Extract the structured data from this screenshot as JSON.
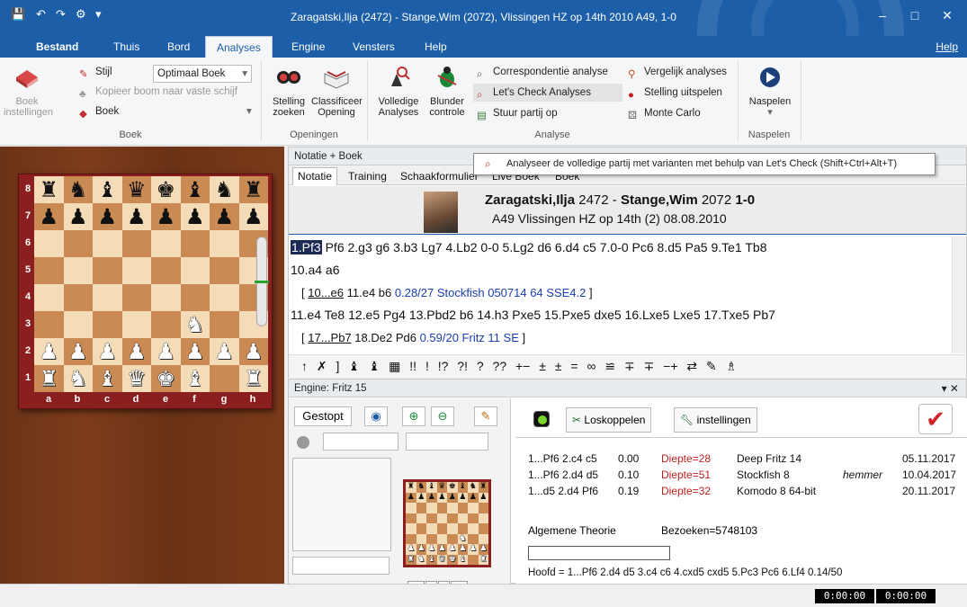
{
  "window": {
    "title": "Zaragatski,Ilja (2472) - Stange,Wim (2072), Vlissingen HZ op 14th 2010  A49, 1-0",
    "quick_access": [
      "💾",
      "↶",
      "↷",
      "⚙",
      "▾"
    ],
    "controls": [
      "–",
      "□",
      "✕"
    ]
  },
  "menu": {
    "items": [
      "Bestand",
      "Thuis",
      "Bord",
      "Analyses",
      "Engine",
      "Vensters",
      "Help"
    ],
    "active": "Analyses",
    "help_link": "Help"
  },
  "ribbon": {
    "boek_group": {
      "label": "Boek",
      "boek_instellingen": "Boek\ninstellingen",
      "stijl": "Stijl",
      "optimaal_boek": "Optimaal Boek",
      "kopieer": "Kopieer boom naar vaste schijf",
      "boek": "Boek"
    },
    "openingen_group": {
      "label": "Openingen",
      "stelling_zoeken": "Stelling\nzoeken",
      "classificeer": "Classificeer\nOpening"
    },
    "analyse_group": {
      "label": "Analyse",
      "volledige": "Volledige\nAnalyses",
      "blunder": "Blunder\ncontrole",
      "correspondentie": "Correspondentie analyse",
      "lets_check": "Let's Check Analyses",
      "stuur_partij": "Stuur partij op",
      "vergelijk": "Vergelijk analyses",
      "stelling_uitspelen": "Stelling uitspelen",
      "monte_carlo": "Monte Carlo"
    },
    "naspelen_group": {
      "label": "Naspelen",
      "naspelen": "Naspelen"
    }
  },
  "tooltip": "Analyseer de volledige partij met varianten met behulp van Let's Check (Shift+Ctrl+Alt+T)",
  "notation": {
    "pane_title": "Notatie + Boek",
    "tabs": [
      "Notatie",
      "Training",
      "Schaakformulier",
      "Live Boek",
      "Boek"
    ],
    "header_line1_white": "Zaragatski,Ilja",
    "header_line1_white_elo": "2472",
    "header_line1_sep": " - ",
    "header_line1_black": "Stange,Wim",
    "header_line1_black_elo": "2072",
    "header_line1_result": "1-0",
    "header_line2": "A49 Vlissingen HZ op 14th (2) 08.08.2010",
    "current_move": "1.Pf3",
    "line1_rest": " Pf6 2.g3 g6 3.b3 Lg7 4.Lb2 0-0 5.Lg2 d6 6.d4 c5 7.0-0 Pc6 8.d5 Pa5 9.Te1 Tb8",
    "line2": "10.a4 a6",
    "var1_open": "[ ",
    "var1_move": "10...e6",
    "var1_moves": " 11.e4 b6 ",
    "var1_eng": "0.28/27 Stockfish 050714 64 SSE4.2",
    "var1_close": " ]",
    "line3": "11.e4 Te8 12.e5 Pg4 13.Pbd2 b6 14.h3 Pxe5 15.Pxe5 dxe5 16.Lxe5 Lxe5 17.Txe5 Pb7",
    "var2_open": "[ ",
    "var2_move": "17...Pb7",
    "var2_moves": " 18.De2 Pd6 ",
    "var2_eng": "0.59/20 Fritz 11 SE",
    "var2_close": " ]",
    "symbols": "↑ ✗ ] ♝ ♝ ▦ !! ! !? ?! ? ?? +− ± ± = ∞ ≌ ∓ ∓ −+ ⇄ ✎ ♗"
  },
  "board": {
    "ranks": [
      "8",
      "7",
      "6",
      "5",
      "4",
      "3",
      "2",
      "1"
    ],
    "files": [
      "a",
      "b",
      "c",
      "d",
      "e",
      "f",
      "g",
      "h"
    ],
    "position": [
      [
        "bR",
        "bN",
        "bB",
        "bQ",
        "bK",
        "bB",
        "bN",
        "bR"
      ],
      [
        "bP",
        "bP",
        "bP",
        "bP",
        "bP",
        "bP",
        "bP",
        "bP"
      ],
      [
        "",
        "",
        "",
        "",
        "",
        "",
        "",
        ""
      ],
      [
        "",
        "",
        "",
        "",
        "",
        "",
        "",
        ""
      ],
      [
        "",
        "",
        "",
        "",
        "",
        "",
        "",
        ""
      ],
      [
        "",
        "",
        "",
        "",
        "",
        "wN",
        "",
        ""
      ],
      [
        "wP",
        "wP",
        "wP",
        "wP",
        "wP",
        "wP",
        "wP",
        "wP"
      ],
      [
        "wR",
        "wN",
        "wB",
        "wQ",
        "wK",
        "wB",
        "",
        "wR"
      ]
    ]
  },
  "engine": {
    "pane_title": "Engine: Fritz 15",
    "status": "Gestopt",
    "loskoppelen": "Loskoppelen",
    "instellingen": "instellingen",
    "book_moves": [
      {
        "moves": "1...Pf6 2.c4 c5",
        "score": "0.00",
        "depth": "Diepte=28",
        "engine": "Deep Fritz 14",
        "user": "",
        "date": "05.11.2017"
      },
      {
        "moves": "1...Pf6 2.d4 d5",
        "score": "0.10",
        "depth": "Diepte=51",
        "engine": "Stockfish 8",
        "user": "hemmer",
        "date": "10.04.2017"
      },
      {
        "moves": "1...d5 2.d4 Pf6",
        "score": "0.19",
        "depth": "Diepte=32",
        "engine": "Komodo 8 64-bit",
        "user": "",
        "date": "20.11.2017"
      }
    ],
    "theory": "Algemene Theorie",
    "visits": "Bezoeken=5748103",
    "main_line": "Hoofd = 1...Pf6 2.d4 d5 3.c4 c6 4.cxd5 cxd5 5.Pc3 Pc6 6.Lf4  0.14/50",
    "mini_nav": [
      "<<",
      "<",
      ">",
      ">>"
    ]
  },
  "status": {
    "clock_white": "0:00:00",
    "clock_black": "0:00:00"
  },
  "colors": {
    "accent": "#1c5ea8",
    "current_move_bg": "#1c2a55",
    "engine_text": "#1a3fb0",
    "depth_red": "#c02020"
  }
}
